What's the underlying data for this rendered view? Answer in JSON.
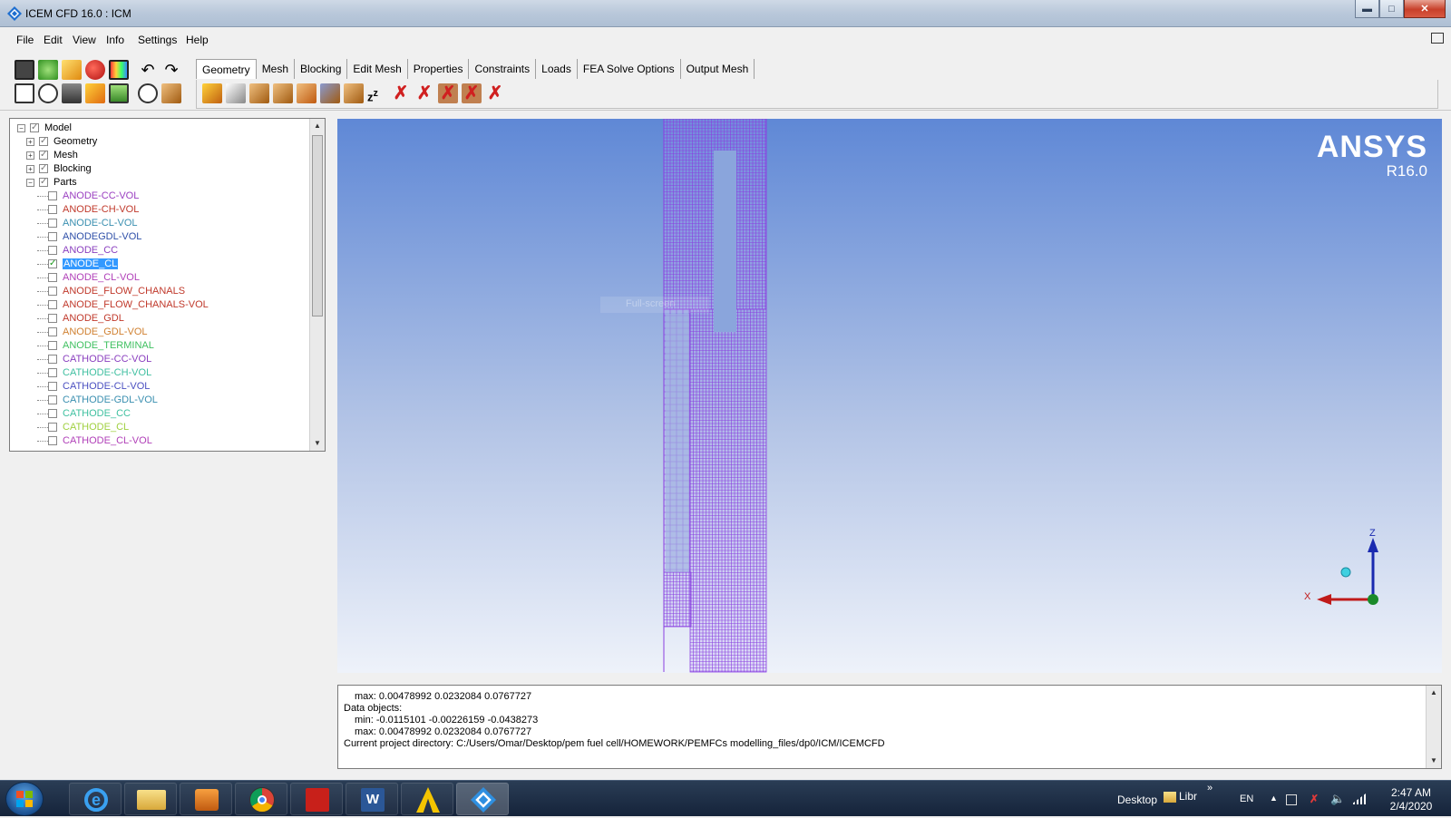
{
  "window": {
    "title": "ICEM CFD 16.0 : ICM"
  },
  "menu": [
    "File",
    "Edit",
    "View",
    "Info",
    "Settings",
    "Help"
  ],
  "tabs": [
    "Geometry",
    "Mesh",
    "Blocking",
    "Edit Mesh",
    "Properties",
    "Constraints",
    "Loads",
    "FEA Solve Options",
    "Output Mesh"
  ],
  "active_tab": "Geometry",
  "tree": {
    "root": "Model",
    "nodes": [
      "Geometry",
      "Mesh",
      "Blocking",
      "Parts"
    ],
    "parts": [
      {
        "name": "ANODE-CC-VOL",
        "color": "#9a3fc1",
        "checked": false
      },
      {
        "name": "ANODE-CH-VOL",
        "color": "#c0392b",
        "checked": false
      },
      {
        "name": "ANODE-CL-VOL",
        "color": "#3a8fb0",
        "checked": false
      },
      {
        "name": "ANODEGDL-VOL",
        "color": "#2e4fa8",
        "checked": false
      },
      {
        "name": "ANODE_CC",
        "color": "#8a3fbf",
        "checked": false
      },
      {
        "name": "ANODE_CL",
        "color": "#ffffff",
        "checked": true,
        "selected": true
      },
      {
        "name": "ANODE_CL-VOL",
        "color": "#b03fb8",
        "checked": false
      },
      {
        "name": "ANODE_FLOW_CHANALS",
        "color": "#c0392b",
        "checked": false
      },
      {
        "name": "ANODE_FLOW_CHANALS-VOL",
        "color": "#c0392b",
        "checked": false
      },
      {
        "name": "ANODE_GDL",
        "color": "#c0392b",
        "checked": false
      },
      {
        "name": "ANODE_GDL-VOL",
        "color": "#d08030",
        "checked": false
      },
      {
        "name": "ANODE_TERMINAL",
        "color": "#3fc060",
        "checked": false
      },
      {
        "name": "CATHODE-CC-VOL",
        "color": "#8a3fbf",
        "checked": false
      },
      {
        "name": "CATHODE-CH-VOL",
        "color": "#3fbfa0",
        "checked": false
      },
      {
        "name": "CATHODE-CL-VOL",
        "color": "#4a4fc0",
        "checked": false
      },
      {
        "name": "CATHODE-GDL-VOL",
        "color": "#3a8fb0",
        "checked": false
      },
      {
        "name": "CATHODE_CC",
        "color": "#3fc0a0",
        "checked": false
      },
      {
        "name": "CATHODE_CL",
        "color": "#a0d040",
        "checked": false
      },
      {
        "name": "CATHODE_CL-VOL",
        "color": "#b03fb8",
        "checked": false
      }
    ]
  },
  "viewport": {
    "brand": "ANSYS",
    "version": "R16.0",
    "watermark": "Full-screen",
    "axes": {
      "z": "Z",
      "x": "X"
    },
    "mesh_color": "#8a3fe0"
  },
  "console": {
    "lines": [
      "max: 0.00478992 0.0232084 0.0767727",
      "Data objects:",
      "min: -0.0115101 -0.00226159 -0.0438273",
      "max: 0.00478992 0.0232084 0.0767727",
      "Current project directory: C:/Users/Omar/Desktop/pem fuel cell/HOMEWORK/PEMFCs modelling_files/dp0/ICM/ICEMCFD"
    ]
  },
  "taskbar": {
    "desktop_label": "Desktop",
    "libraries_label": "Libr",
    "chevron": "»",
    "language": "EN",
    "time": "2:47 AM",
    "date": "2/4/2020"
  }
}
